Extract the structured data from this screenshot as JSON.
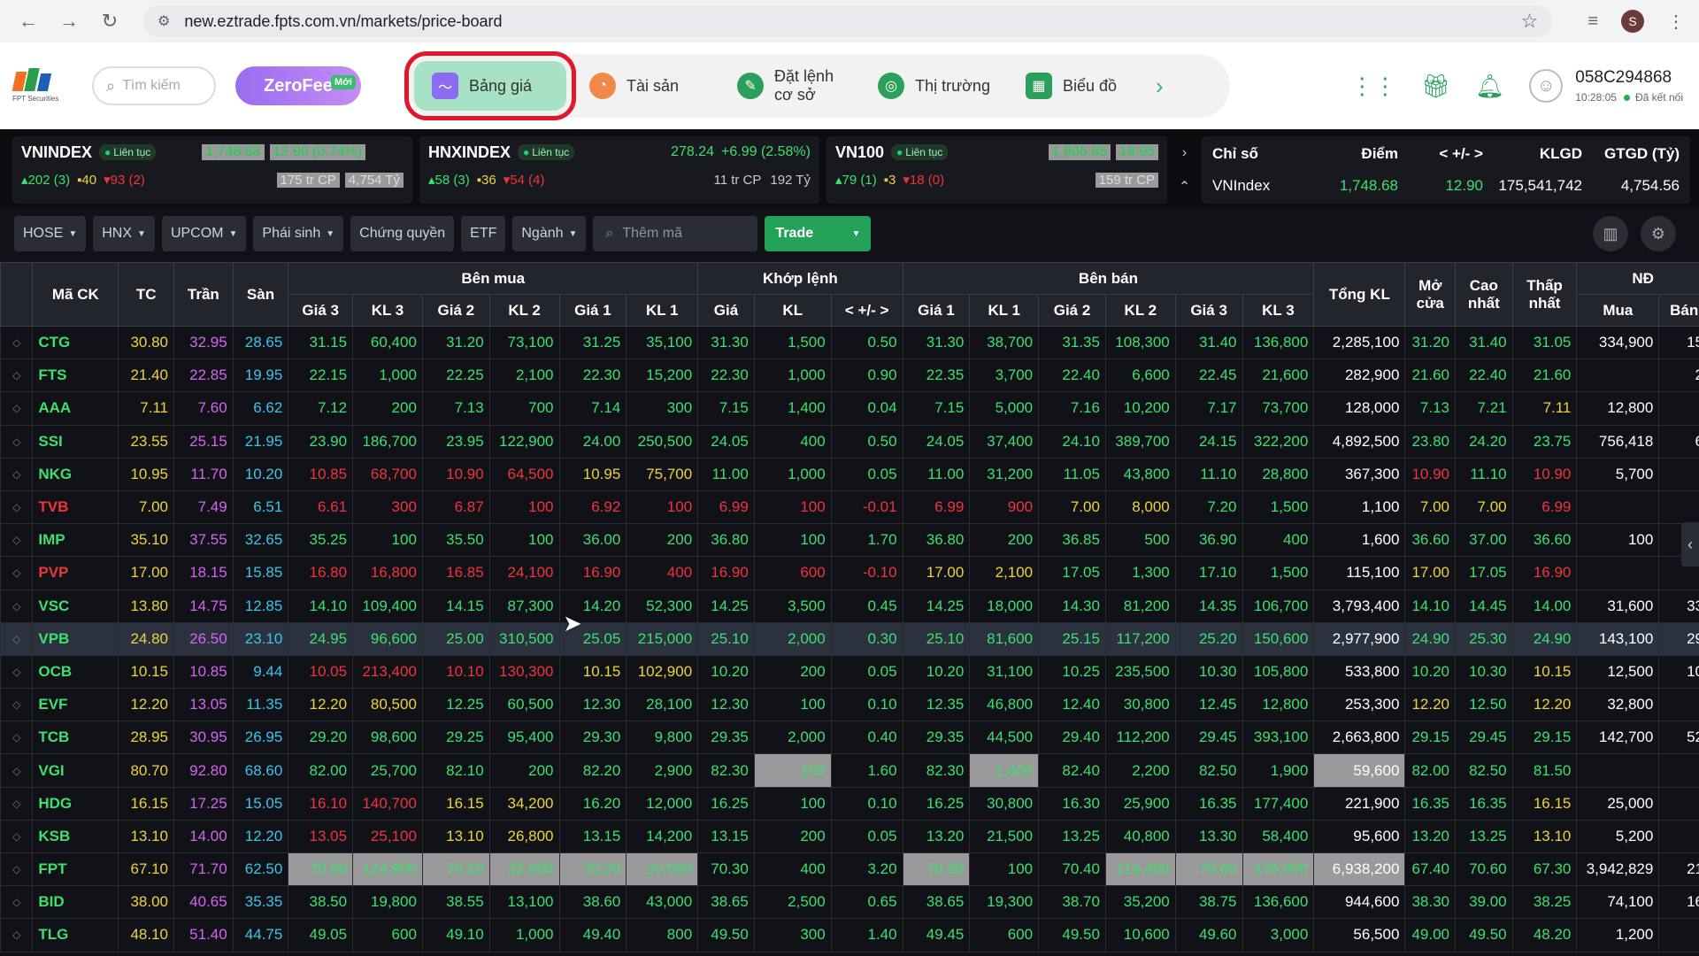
{
  "browser": {
    "url": "new.eztrade.fpts.com.vn/markets/price-board",
    "profile_initial": "S"
  },
  "header": {
    "logo_text": "FPT Securities",
    "search_placeholder": "Tìm kiếm",
    "zerofee_label": "ZeroFee",
    "zerofee_badge": "Mới",
    "nav": [
      {
        "label": "Bảng giá",
        "icon": "price-board-icon",
        "active": true
      },
      {
        "label": "Tài sản",
        "icon": "pie-icon"
      },
      {
        "label1": "Đặt lệnh",
        "label2": "cơ sở",
        "icon": "order-icon"
      },
      {
        "label": "Thị trường",
        "icon": "market-icon"
      },
      {
        "label": "Biểu đồ",
        "icon": "chart-icon"
      }
    ],
    "account": {
      "id": "058C294868",
      "time": "10:28:05",
      "status": "Đã kết nối"
    }
  },
  "indices": [
    {
      "name": "VNINDEX",
      "status": "Liên tục",
      "value": "1,748.68",
      "change": "12.90 (0.74%)",
      "adv": "202 (3)",
      "unch": "40",
      "dec": "93 (2)",
      "vol": "175 tr CP",
      "val": "4,754 Tỷ"
    },
    {
      "name": "HNXINDEX",
      "status": "Liên tục",
      "value": "278.24",
      "change": "+6.99 (2.58%)",
      "adv": "58 (3)",
      "unch": "36",
      "dec": "54 (4)",
      "vol": "11 tr CP",
      "val": "192 Tỷ"
    },
    {
      "name": "VN100",
      "status": "Liên tục",
      "value": "1,805.85",
      "change": "18.95",
      "adv": "79 (1)",
      "unch": "3",
      "dec": "18 (0)",
      "vol": "159 tr CP",
      "val": ""
    }
  ],
  "index_table": {
    "headers": [
      "Chỉ số",
      "Điểm",
      "< +/- >",
      "KLGD",
      "GTGD (Tỷ)"
    ],
    "row": [
      "VNIndex",
      "1,748.68",
      "12.90",
      "175,541,742",
      "4,754.56"
    ]
  },
  "filters": [
    "HOSE",
    "HNX",
    "UPCOM",
    "Phái sinh",
    "Chứng quyền",
    "ETF",
    "Ngành"
  ],
  "filters_dropdown": [
    true,
    true,
    true,
    true,
    false,
    false,
    true
  ],
  "add_symbol_placeholder": "Thêm mã",
  "trade_label": "Trade",
  "table": {
    "group_headers": {
      "buy": "Bên mua",
      "match": "Khớp lệnh",
      "sell": "Bên bán",
      "foreign": "NĐ"
    },
    "headers": {
      "sym": "Mã CK",
      "ref": "TC",
      "ceil": "Trần",
      "floor": "Sàn",
      "b3": "Giá 3",
      "bv3": "KL 3",
      "b2": "Giá 2",
      "bv2": "KL 2",
      "b1": "Giá 1",
      "bv1": "KL 1",
      "mp": "Giá",
      "mv": "KL",
      "chg": "< +/- >",
      "s1": "Giá 1",
      "sv1": "KL 1",
      "s2": "Giá 2",
      "sv2": "KL 2",
      "s3": "Giá 3",
      "sv3": "KL 3",
      "tot": "Tổng KL",
      "open": "Mở cửa",
      "high": "Cao nhất",
      "low": "Thấp nhất",
      "fbuy": "Mua",
      "fsell": "Bán"
    },
    "rows": [
      [
        "CTG",
        "30.80",
        "32.95",
        "28.65",
        "31.15",
        "60,400",
        "31.20",
        "73,100",
        "31.25",
        "35,100",
        "31.30",
        "1,500",
        "0.50",
        "31.30",
        "38,700",
        "31.35",
        "108,300",
        "31.40",
        "136,800",
        "2,285,100",
        "31.20",
        "31.40",
        "31.05",
        "334,900",
        "15"
      ],
      [
        "FTS",
        "21.40",
        "22.85",
        "19.95",
        "22.15",
        "1,000",
        "22.25",
        "2,100",
        "22.30",
        "15,200",
        "22.30",
        "1,000",
        "0.90",
        "22.35",
        "3,700",
        "22.40",
        "6,600",
        "22.45",
        "21,600",
        "282,900",
        "21.60",
        "22.40",
        "21.60",
        "",
        "2"
      ],
      [
        "AAA",
        "7.11",
        "7.60",
        "6.62",
        "7.12",
        "200",
        "7.13",
        "700",
        "7.14",
        "300",
        "7.15",
        "1,400",
        "0.04",
        "7.15",
        "5,000",
        "7.16",
        "10,200",
        "7.17",
        "73,700",
        "128,000",
        "7.13",
        "7.21",
        "7.11",
        "12,800",
        ""
      ],
      [
        "SSI",
        "23.55",
        "25.15",
        "21.95",
        "23.90",
        "186,700",
        "23.95",
        "122,900",
        "24.00",
        "250,500",
        "24.05",
        "400",
        "0.50",
        "24.05",
        "37,400",
        "24.10",
        "389,700",
        "24.15",
        "322,200",
        "4,892,500",
        "23.80",
        "24.20",
        "23.75",
        "756,418",
        "6"
      ],
      [
        "NKG",
        "10.95",
        "11.70",
        "10.20",
        "10.85",
        "68,700",
        "10.90",
        "64,500",
        "10.95",
        "75,700",
        "11.00",
        "1,000",
        "0.05",
        "11.00",
        "31,200",
        "11.05",
        "43,800",
        "11.10",
        "28,800",
        "367,300",
        "10.90",
        "11.10",
        "10.90",
        "5,700",
        ""
      ],
      [
        "TVB",
        "7.00",
        "7.49",
        "6.51",
        "6.61",
        "300",
        "6.87",
        "100",
        "6.92",
        "100",
        "6.99",
        "100",
        "-0.01",
        "6.99",
        "900",
        "7.00",
        "8,000",
        "7.20",
        "1,500",
        "1,100",
        "7.00",
        "7.00",
        "6.99",
        "",
        ""
      ],
      [
        "IMP",
        "35.10",
        "37.55",
        "32.65",
        "35.25",
        "100",
        "35.50",
        "100",
        "36.00",
        "200",
        "36.80",
        "100",
        "1.70",
        "36.80",
        "200",
        "36.85",
        "500",
        "36.90",
        "400",
        "1,600",
        "36.60",
        "37.00",
        "36.60",
        "100",
        ""
      ],
      [
        "PVP",
        "17.00",
        "18.15",
        "15.85",
        "16.80",
        "16,800",
        "16.85",
        "24,100",
        "16.90",
        "400",
        "16.90",
        "600",
        "-0.10",
        "17.00",
        "2,100",
        "17.05",
        "1,300",
        "17.10",
        "1,500",
        "115,100",
        "17.00",
        "17.05",
        "16.90",
        "",
        ""
      ],
      [
        "VSC",
        "13.80",
        "14.75",
        "12.85",
        "14.10",
        "109,400",
        "14.15",
        "87,300",
        "14.20",
        "52,300",
        "14.25",
        "3,500",
        "0.45",
        "14.25",
        "18,000",
        "14.30",
        "81,200",
        "14.35",
        "106,700",
        "3,793,400",
        "14.10",
        "14.45",
        "14.00",
        "31,600",
        "33"
      ],
      [
        "VPB",
        "24.80",
        "26.50",
        "23.10",
        "24.95",
        "96,600",
        "25.00",
        "310,500",
        "25.05",
        "215,000",
        "25.10",
        "2,000",
        "0.30",
        "25.10",
        "81,600",
        "25.15",
        "117,200",
        "25.20",
        "150,600",
        "2,977,900",
        "24.90",
        "25.30",
        "24.90",
        "143,100",
        "29"
      ],
      [
        "OCB",
        "10.15",
        "10.85",
        "9.44",
        "10.05",
        "213,400",
        "10.10",
        "130,300",
        "10.15",
        "102,900",
        "10.20",
        "200",
        "0.05",
        "10.20",
        "31,100",
        "10.25",
        "235,500",
        "10.30",
        "105,800",
        "533,800",
        "10.20",
        "10.30",
        "10.15",
        "12,500",
        "10"
      ],
      [
        "EVF",
        "12.20",
        "13.05",
        "11.35",
        "12.20",
        "80,500",
        "12.25",
        "60,500",
        "12.30",
        "28,100",
        "12.30",
        "100",
        "0.10",
        "12.35",
        "46,800",
        "12.40",
        "30,800",
        "12.45",
        "12,800",
        "253,300",
        "12.20",
        "12.50",
        "12.20",
        "32,800",
        ""
      ],
      [
        "TCB",
        "28.95",
        "30.95",
        "26.95",
        "29.20",
        "98,600",
        "29.25",
        "95,400",
        "29.30",
        "9,800",
        "29.35",
        "2,000",
        "0.40",
        "29.35",
        "44,500",
        "29.40",
        "112,200",
        "29.45",
        "393,100",
        "2,663,800",
        "29.15",
        "29.45",
        "29.15",
        "142,700",
        "52"
      ],
      [
        "VGI",
        "80.70",
        "92.80",
        "68.60",
        "82.00",
        "25,700",
        "82.10",
        "200",
        "82.20",
        "2,900",
        "82.30",
        "100",
        "1.60",
        "82.30",
        "1,400",
        "82.40",
        "2,200",
        "82.50",
        "1,900",
        "59,600",
        "82.00",
        "82.50",
        "81.50",
        "",
        ""
      ],
      [
        "HDG",
        "16.15",
        "17.25",
        "15.05",
        "16.10",
        "140,700",
        "16.15",
        "34,200",
        "16.20",
        "12,000",
        "16.25",
        "100",
        "0.10",
        "16.25",
        "30,800",
        "16.30",
        "25,900",
        "16.35",
        "177,400",
        "221,900",
        "16.35",
        "16.35",
        "16.15",
        "25,000",
        ""
      ],
      [
        "KSB",
        "13.10",
        "14.00",
        "12.20",
        "13.05",
        "25,100",
        "13.10",
        "26,800",
        "13.15",
        "14,200",
        "13.15",
        "200",
        "0.05",
        "13.20",
        "21,500",
        "13.25",
        "40,800",
        "13.30",
        "58,400",
        "95,600",
        "13.20",
        "13.25",
        "13.10",
        "5,200",
        ""
      ],
      [
        "FPT",
        "67.10",
        "71.70",
        "62.50",
        "70.00",
        "124,900",
        "70.10",
        "32,000",
        "70.20",
        "20,000",
        "70.30",
        "400",
        "3.20",
        "70.30",
        "100",
        "70.40",
        "114,400",
        "70.60",
        "176,900",
        "6,938,200",
        "67.40",
        "70.60",
        "67.30",
        "3,942,829",
        "21"
      ],
      [
        "BID",
        "38.00",
        "40.65",
        "35.35",
        "38.50",
        "19,800",
        "38.55",
        "13,100",
        "38.60",
        "43,000",
        "38.65",
        "2,500",
        "0.65",
        "38.65",
        "19,300",
        "38.70",
        "35,200",
        "38.75",
        "136,600",
        "944,600",
        "38.30",
        "39.00",
        "38.25",
        "74,100",
        "16"
      ],
      [
        "TLG",
        "48.10",
        "51.40",
        "44.75",
        "49.05",
        "600",
        "49.10",
        "1,000",
        "49.40",
        "800",
        "49.50",
        "300",
        "1.40",
        "49.45",
        "600",
        "49.50",
        "10,600",
        "49.60",
        "3,000",
        "56,500",
        "49.00",
        "49.50",
        "48.20",
        "1,200",
        ""
      ]
    ]
  },
  "colors": {
    "up": "#3ee06d",
    "down": "#f0343c",
    "ref": "#f0d23c",
    "ceiling": "#d564f0",
    "floor": "#3ac5ea",
    "accent": "#24a25a",
    "highlight": "#e0182b"
  }
}
